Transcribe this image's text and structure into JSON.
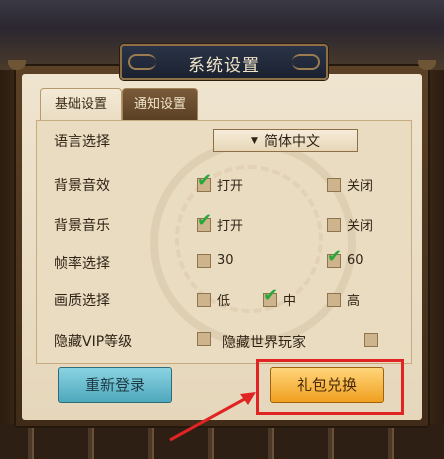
{
  "dialog": {
    "title": "系统设置"
  },
  "tabs": [
    {
      "label": "基础设置",
      "active": true
    },
    {
      "label": "通知设置",
      "active": false
    }
  ],
  "settings": {
    "language": {
      "label": "语言选择",
      "value": "简体中文"
    },
    "bg_sound": {
      "label": "背景音效",
      "on_label": "打开",
      "off_label": "关闭",
      "on_checked": true,
      "off_checked": false
    },
    "bg_music": {
      "label": "背景音乐",
      "on_label": "打开",
      "off_label": "关闭",
      "on_checked": true,
      "off_checked": false
    },
    "framerate": {
      "label": "帧率选择",
      "opt1": "30",
      "opt2": "60",
      "opt1_checked": false,
      "opt2_checked": true
    },
    "quality": {
      "label": "画质选择",
      "low": "低",
      "mid": "中",
      "high": "高",
      "low_checked": false,
      "mid_checked": true,
      "high_checked": false
    },
    "hide_vip": {
      "label": "隐藏VIP等级",
      "checked": false
    },
    "hide_players": {
      "label": "隐藏世界玩家",
      "checked": false
    }
  },
  "buttons": {
    "relogin": "重新登录",
    "gift_redeem": "礼包兑换"
  },
  "colors": {
    "highlight": "#e02424",
    "check": "#26a83a"
  }
}
